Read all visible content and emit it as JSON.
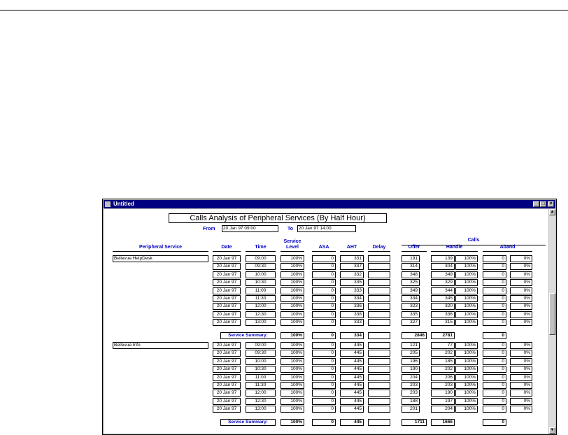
{
  "window": {
    "title": "Untitled"
  },
  "report": {
    "title": "Calls Analysis of Peripheral Services (By Half Hour)",
    "from_label": "From",
    "from_value": "20 Jan 97  09:00",
    "to_label": "To",
    "to_value": "20 Jan 97  14:00",
    "headers": {
      "peripheral_service": "Peripheral Service",
      "date": "Date",
      "time": "Time",
      "service_level_1": "Service",
      "service_level_2": "Level",
      "asa": "ASA",
      "aht": "AHT",
      "delay": "Delay",
      "calls": "Calls",
      "offer": "Offer",
      "handle": "Handle",
      "aband": "Aband"
    },
    "summary_label": "Service Summary:",
    "groups": [
      {
        "service": "Bellevue.HelpDesk",
        "rows": [
          {
            "date": "20 Jan 97",
            "time": "09:00",
            "sl": "100%",
            "asa": "0",
            "aht": "331",
            "delay": "",
            "offer": "191",
            "handle": "139",
            "handle_pct": "100%",
            "aband": "0",
            "aband_pct": "0%"
          },
          {
            "date": "20 Jan 97",
            "time": "09:30",
            "sl": "100%",
            "asa": "0",
            "aht": "337",
            "delay": "",
            "offer": "314",
            "handle": "304",
            "handle_pct": "100%",
            "aband": "0",
            "aband_pct": "0%"
          },
          {
            "date": "20 Jan 97",
            "time": "10:00",
            "sl": "100%",
            "asa": "0",
            "aht": "332",
            "delay": "",
            "offer": "348",
            "handle": "349",
            "handle_pct": "100%",
            "aband": "0",
            "aband_pct": "0%"
          },
          {
            "date": "20 Jan 97",
            "time": "10:30",
            "sl": "100%",
            "asa": "0",
            "aht": "335",
            "delay": "",
            "offer": "325",
            "handle": "329",
            "handle_pct": "100%",
            "aband": "0",
            "aband_pct": "0%"
          },
          {
            "date": "20 Jan 97",
            "time": "11:00",
            "sl": "100%",
            "asa": "0",
            "aht": "333",
            "delay": "",
            "offer": "349",
            "handle": "344",
            "handle_pct": "100%",
            "aband": "0",
            "aband_pct": "0%"
          },
          {
            "date": "20 Jan 97",
            "time": "11:30",
            "sl": "100%",
            "asa": "0",
            "aht": "334",
            "delay": "",
            "offer": "334",
            "handle": "345",
            "handle_pct": "100%",
            "aband": "0",
            "aband_pct": "0%"
          },
          {
            "date": "20 Jan 97",
            "time": "12:00",
            "sl": "100%",
            "asa": "0",
            "aht": "336",
            "delay": "",
            "offer": "323",
            "handle": "320",
            "handle_pct": "100%",
            "aband": "0",
            "aband_pct": "0%"
          },
          {
            "date": "20 Jan 97",
            "time": "12:30",
            "sl": "100%",
            "asa": "0",
            "aht": "338",
            "delay": "",
            "offer": "335",
            "handle": "336",
            "handle_pct": "100%",
            "aband": "0",
            "aband_pct": "0%"
          },
          {
            "date": "20 Jan 97",
            "time": "13:00",
            "sl": "100%",
            "asa": "0",
            "aht": "333",
            "delay": "",
            "offer": "327",
            "handle": "315",
            "handle_pct": "100%",
            "aband": "0",
            "aband_pct": "0%"
          }
        ],
        "summary": {
          "sl": "100%",
          "asa": "0",
          "aht": "334",
          "delay": "",
          "offer": "2846",
          "handle": "2781",
          "aband": "0"
        }
      },
      {
        "service": "Bellevue.Info",
        "rows": [
          {
            "date": "20 Jan 97",
            "time": "09:00",
            "sl": "100%",
            "asa": "0",
            "aht": "445",
            "delay": "",
            "offer": "121",
            "handle": "77",
            "handle_pct": "100%",
            "aband": "0",
            "aband_pct": "0%"
          },
          {
            "date": "20 Jan 97",
            "time": "09:30",
            "sl": "100%",
            "asa": "0",
            "aht": "445",
            "delay": "",
            "offer": "205",
            "handle": "202",
            "handle_pct": "100%",
            "aband": "0",
            "aband_pct": "0%"
          },
          {
            "date": "20 Jan 97",
            "time": "10:00",
            "sl": "100%",
            "asa": "0",
            "aht": "445",
            "delay": "",
            "offer": "196",
            "handle": "185",
            "handle_pct": "100%",
            "aband": "0",
            "aband_pct": "0%"
          },
          {
            "date": "20 Jan 97",
            "time": "10:30",
            "sl": "100%",
            "asa": "0",
            "aht": "445",
            "delay": "",
            "offer": "190",
            "handle": "202",
            "handle_pct": "100%",
            "aband": "0",
            "aband_pct": "0%"
          },
          {
            "date": "20 Jan 97",
            "time": "11:00",
            "sl": "100%",
            "asa": "0",
            "aht": "445",
            "delay": "",
            "offer": "204",
            "handle": "206",
            "handle_pct": "100%",
            "aband": "0",
            "aband_pct": "0%"
          },
          {
            "date": "20 Jan 97",
            "time": "11:30",
            "sl": "100%",
            "asa": "0",
            "aht": "445",
            "delay": "",
            "offer": "203",
            "handle": "203",
            "handle_pct": "100%",
            "aband": "0",
            "aband_pct": "0%"
          },
          {
            "date": "20 Jan 97",
            "time": "12:00",
            "sl": "100%",
            "asa": "0",
            "aht": "445",
            "delay": "",
            "offer": "203",
            "handle": "190",
            "handle_pct": "100%",
            "aband": "0",
            "aband_pct": "0%"
          },
          {
            "date": "20 Jan 97",
            "time": "12:30",
            "sl": "100%",
            "asa": "0",
            "aht": "445",
            "delay": "",
            "offer": "188",
            "handle": "197",
            "handle_pct": "100%",
            "aband": "0",
            "aband_pct": "0%"
          },
          {
            "date": "20 Jan 97",
            "time": "13:00",
            "sl": "100%",
            "asa": "0",
            "aht": "445",
            "delay": "",
            "offer": "201",
            "handle": "204",
            "handle_pct": "100%",
            "aband": "0",
            "aband_pct": "0%"
          }
        ],
        "summary": {
          "sl": "100%",
          "asa": "0",
          "aht": "445",
          "delay": "",
          "offer": "1711",
          "handle": "1666",
          "aband": "0"
        }
      }
    ]
  }
}
